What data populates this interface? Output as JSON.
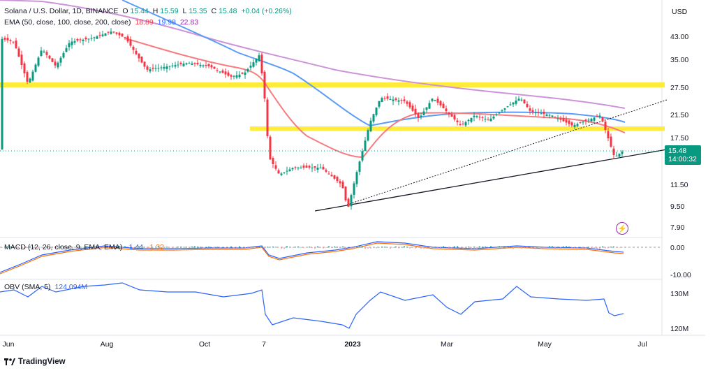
{
  "header": {
    "symbol": "Solana / U.S. Dollar, 1D, BINANCE",
    "open_label": "O",
    "open": "15.44",
    "high_label": "H",
    "high": "15.59",
    "low_label": "L",
    "low": "15.35",
    "close_label": "C",
    "close": "15.48",
    "change": "+0.04 (+0.26%)"
  },
  "ema_legend": {
    "label": "EMA (50, close, 100, close, 200, close)",
    "ema50": "18.89",
    "ema100": "19.98",
    "ema200": "22.83",
    "colors": {
      "ema50": "#f77c80",
      "ema100": "#5b9cf6",
      "ema200": "#ce93d8"
    }
  },
  "macd_legend": {
    "label": "MACD (12, 26, close, 9, EMA, EMA)",
    "macd": "-1.44",
    "signal": "-1.32"
  },
  "obv_legend": {
    "label": "OBV (SMA, 5)",
    "value": "124.094M"
  },
  "currency": "USD",
  "price_tag": {
    "price": "15.48",
    "countdown": "14:00:32"
  },
  "brand": "TradingView",
  "colors": {
    "up": "#089981",
    "down": "#f23645",
    "zone": "#ffeb3b",
    "macd": "#2962ff",
    "signal": "#ff6d00",
    "obv": "#2962ff"
  },
  "chart_data": {
    "type": "candlestick",
    "y_scale": "log",
    "y_ticks": [
      "43.00",
      "35.00",
      "27.50",
      "21.50",
      "17.50",
      "11.50",
      "9.50",
      "7.90"
    ],
    "x_ticks": [
      "Jun",
      "Aug",
      "Oct",
      "7",
      "2023",
      "Mar",
      "May",
      "Jul"
    ],
    "macd_ticks": [
      "0.00",
      "-10.00"
    ],
    "obv_ticks": [
      "130M",
      "120M"
    ],
    "series": [
      {
        "name": "EMA 50"
      },
      {
        "name": "EMA 100"
      },
      {
        "name": "EMA 200"
      }
    ],
    "horizontal_levels": [
      28.0,
      18.8
    ],
    "last_price": 15.48
  }
}
